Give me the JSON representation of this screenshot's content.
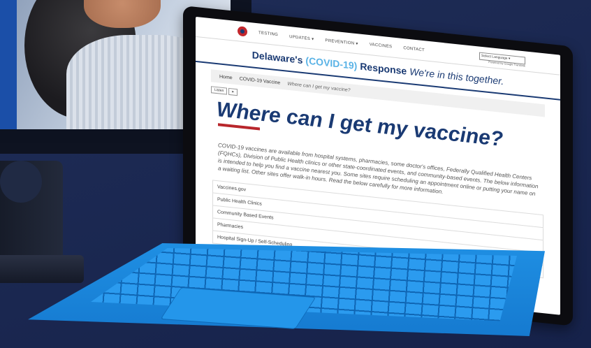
{
  "nav": {
    "items": [
      "TESTING",
      "UPDATES ▾",
      "PREVENTION ▾",
      "VACCINES",
      "CONTACT"
    ],
    "language_select": "Select Language  ▾",
    "language_powered": "Powered by Google Translate"
  },
  "banner": {
    "part1": "Delaware's",
    "part2": "(COVID-19)",
    "part3": "Response",
    "tagline": "We're in this together."
  },
  "breadcrumb": {
    "home": "Home",
    "section": "COVID-19 Vaccine",
    "current": "Where can I get my vaccine?"
  },
  "listen": {
    "label": "Listen",
    "arrow": "▸"
  },
  "page": {
    "heading": "Where can I get my vaccine?",
    "intro": "COVID-19 vaccines are available from hospital systems, pharmacies, some doctor's offices, Federally Qualified Health Centers (FQHCs), Division of Public Health clinics or other state-coordinated events, and community-based events. The below information is intended to help you find a vaccine nearest you. Some sites require scheduling an appointment online or putting your name on a waiting list. Other sites offer walk-in hours. Read the below carefully for more information."
  },
  "accordion": [
    "Vaccines.gov",
    "Public Health Clinics",
    "Community Based Events",
    "Pharmacies",
    "Hospital Sign-Up / Self-Scheduling"
  ],
  "colors": {
    "navy": "#1a3a73",
    "light_blue": "#5ab3e6",
    "red_rule": "#b8262b",
    "keyboard_blue": "#1f8fe3",
    "background": "#1f2d57"
  }
}
